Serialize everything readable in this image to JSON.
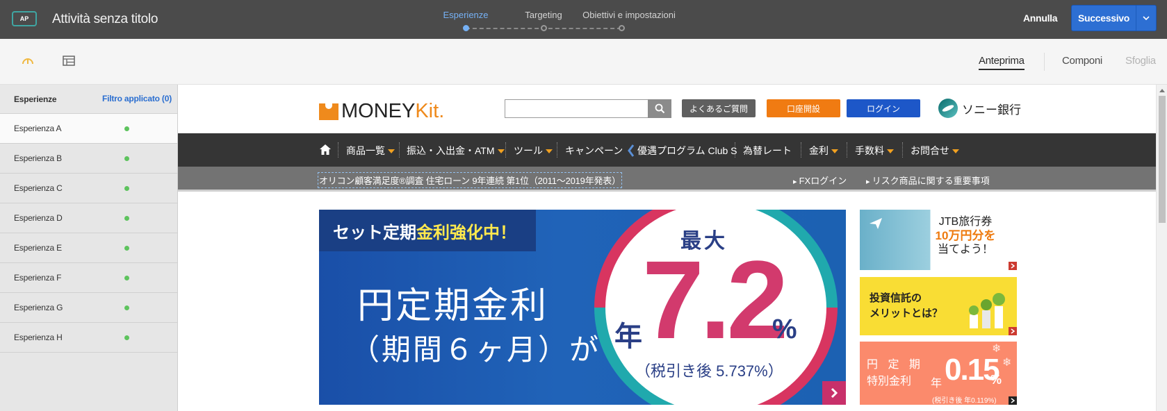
{
  "header": {
    "badge": "AP",
    "activity_title": "Attività senza titolo",
    "steps": [
      {
        "label": "Esperienze",
        "active": true
      },
      {
        "label": "Targeting",
        "active": false
      },
      {
        "label": "Obiettivi e impostazioni",
        "active": false
      }
    ],
    "cancel_label": "Annulla",
    "next_label": "Successivo"
  },
  "toolbar": {
    "left_icons": [
      "gauge-icon",
      "layout-icon"
    ],
    "views": [
      {
        "label": "Anteprima",
        "state": "active"
      },
      {
        "label": "Componi",
        "state": "normal"
      },
      {
        "label": "Sfoglia",
        "state": "disabled"
      }
    ]
  },
  "sidebar": {
    "title": "Esperienze",
    "filter_label": "Filtro applicato (0)",
    "items": [
      {
        "label": "Esperienza A",
        "selected": true
      },
      {
        "label": "Esperienza B",
        "selected": false
      },
      {
        "label": "Esperienza C",
        "selected": false
      },
      {
        "label": "Esperienza D",
        "selected": false
      },
      {
        "label": "Esperienza E",
        "selected": false
      },
      {
        "label": "Esperienza F",
        "selected": false
      },
      {
        "label": "Esperienza G",
        "selected": false
      },
      {
        "label": "Esperienza H",
        "selected": false
      }
    ],
    "status_color": "#5ec35e"
  },
  "site": {
    "logo": {
      "part1": "MONEY",
      "part2": "Kit",
      "mark": "."
    },
    "buttons": {
      "faq": "よくあるご質問",
      "open_account": "口座開設",
      "login": "ログイン"
    },
    "bank_name": "ソニー銀行",
    "nav": [
      {
        "label": "商品一覧",
        "dropdown": true
      },
      {
        "label": "振込・入出金・ATM",
        "dropdown": true
      },
      {
        "label": "ツール",
        "dropdown": true
      },
      {
        "label": "キャンペーン",
        "dropdown": false
      },
      {
        "label": "優遇プログラム Club S",
        "dropdown": false
      },
      {
        "label": "為替レート",
        "dropdown": false
      },
      {
        "label": "金利",
        "dropdown": true
      },
      {
        "label": "手数料",
        "dropdown": true
      },
      {
        "label": "お問合せ",
        "dropdown": true
      }
    ],
    "subbar": {
      "notice": "オリコン顧客満足度®調査 住宅ローン 9年連続 第1位（2011～2019年発表）",
      "links": [
        "FXログイン",
        "リスク商品に関する重要事項"
      ]
    },
    "hero": {
      "tag_prefix": "セット定期",
      "tag_highlight": "金利強化中！",
      "line1": "円定期金利",
      "line2": "（期間６ヶ月）が",
      "max_label": "最大",
      "year_label": "年",
      "rate": "7.2",
      "percent": "%",
      "after_tax": "（税引き後 5.737%）"
    },
    "side_banners": {
      "jtb": {
        "line1": "JTB旅行券",
        "line2": "10万円分を",
        "line3": "当てよう！"
      },
      "fund": {
        "line1": "投資信託の",
        "line2": "メリットとは？"
      },
      "deposit": {
        "line1": "円 定 期",
        "line2": "特別金利",
        "year": "年",
        "rate": "0.15",
        "percent": "%",
        "after_tax": "(税引き後 年0.119%)"
      }
    }
  },
  "colors": {
    "topbar_bg": "#4b4b4b",
    "accent_blue": "#2d6fd3",
    "step_active": "#76b1f5",
    "site_orange": "#f07b12",
    "site_blue": "#1d57c8"
  }
}
